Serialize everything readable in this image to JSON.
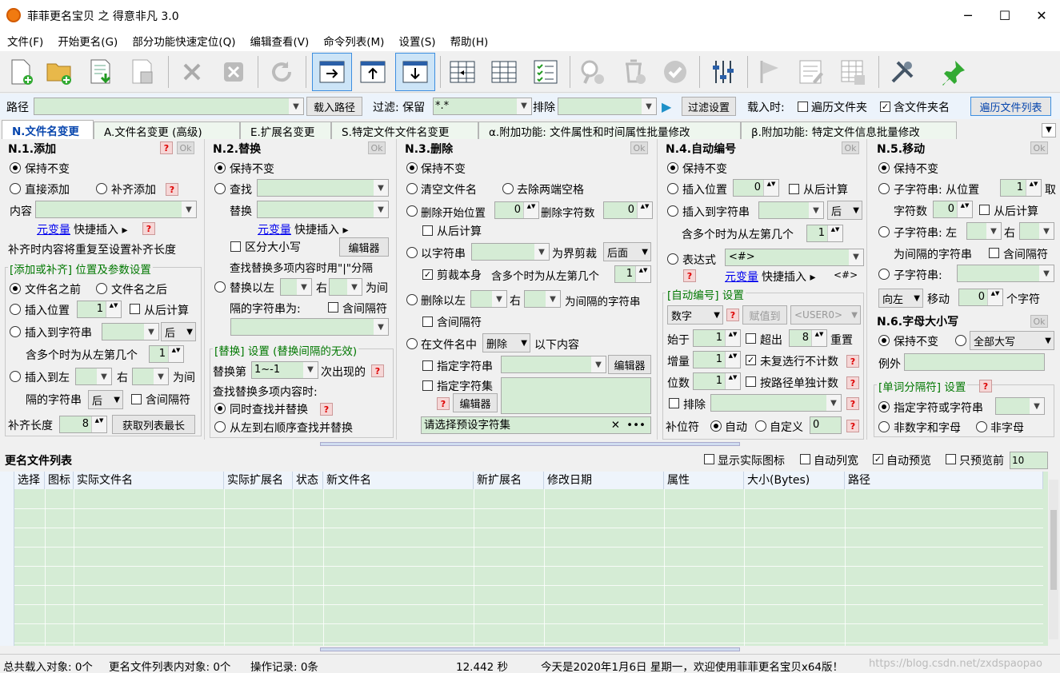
{
  "window": {
    "title": "菲菲更名宝贝 之 得意非凡 3.0",
    "min": "─",
    "max": "☐",
    "close": "✕"
  },
  "menu": [
    "文件(F)",
    "开始更名(G)",
    "部分功能快速定位(Q)",
    "编辑查看(V)",
    "命令列表(M)",
    "设置(S)",
    "帮助(H)"
  ],
  "pathbar": {
    "path_label": "路径",
    "load_path": "载入路径",
    "filter_label": "过滤: 保留",
    "filter_value": "*.*",
    "exclude_label": "排除",
    "filter_settings": "过滤设置",
    "on_load": "载入时:",
    "traverse_folder": "遍历文件夹",
    "include_folder_name": "含文件夹名",
    "traverse_list": "遍历文件列表"
  },
  "tabs": [
    "N.文件名变更",
    "A.文件名变更 (高级)",
    "E.扩展名变更",
    "S.特定文件文件名变更",
    "α.附加功能: 文件属性和时间属性批量修改",
    "β.附加功能: 特定文件信息批量修改"
  ],
  "common": {
    "ok": "Ok",
    "q": "?",
    "after": "后",
    "left": "左",
    "right": "右",
    "ex_tpl": "<#>"
  },
  "p1": {
    "title": "N.1.添加",
    "keep": "保持不变",
    "direct_add": "直接添加",
    "pad_add": "补齐添加",
    "content": "内容",
    "var": "元变量",
    "quick_insert": "快捷插入 ▸",
    "pad_note": "补齐时内容将重复至设置补齐长度",
    "group": "[添加或补齐] 位置及参数设置",
    "before_name": "文件名之前",
    "after_name": "文件名之后",
    "insert_pos": "插入位置",
    "pos_val": "1",
    "from_end": "从后计算",
    "insert_to_str": "插入到字符串",
    "multi_left": "含多个时为从左第几个",
    "multi_val": "1",
    "insert_left": "插入到左",
    "right": "右",
    "as_between": "为间",
    "between_str": "隔的字符串",
    "contain_sep": "含间隔符",
    "pad_len": "补齐长度",
    "pad_val": "8",
    "get_max": "获取列表最长"
  },
  "p2": {
    "title": "N.2.替换",
    "keep": "保持不变",
    "find": "查找",
    "replace": "替换",
    "var": "元变量",
    "quick_insert": "快捷插入 ▸",
    "case": "区分大小写",
    "editor": "编辑器",
    "multi_note": "查找替换多项内容时用\"|\"分隔",
    "replace_left": "替换以左",
    "right": "右",
    "as_between": "为间",
    "between_str": "隔的字符串为:",
    "contain_sep": "含间隔符",
    "group": "[替换] 设置 (替换间隔的无效)",
    "replace_nth": "替换第",
    "nth_val": "1~-1",
    "nth_suffix": "次出现的",
    "multi_find": "查找替换多项内容时:",
    "simultaneous": "同时查找并替换",
    "lr_order": "从左到右顺序查找并替换"
  },
  "p3": {
    "title": "N.3.删除",
    "keep": "保持不变",
    "clear": "清空文件名",
    "trim": "去除两端空格",
    "del_start": "删除开始位置",
    "start_val": "0",
    "del_count": "删除字符数",
    "count_val": "0",
    "from_end": "从后计算",
    "by_str": "以字符串",
    "as_cut": "为界剪裁",
    "after": "后面",
    "cut_self": "剪裁本身",
    "multi_left": "含多个时为从左第几个",
    "multi_val": "1",
    "del_left": "删除以左",
    "right": "右",
    "as_between": "为间隔的字符串",
    "contain_sep": "含间隔符",
    "in_name": "在文件名中",
    "delete_op": "删除",
    "following": "以下内容",
    "spec_str": "指定字符串",
    "editor": "编辑器",
    "spec_set": "指定字符集",
    "preset": "请选择预设字符集",
    "preset_x": "✕",
    "preset_more": "•••"
  },
  "p4": {
    "title": "N.4.自动编号",
    "keep": "保持不变",
    "insert_pos": "插入位置",
    "pos_val": "0",
    "from_end": "从后计算",
    "insert_to_str": "插入到字符串",
    "multi_left": "含多个时为从左第几个",
    "multi_val": "1",
    "expr": "表达式",
    "var": "元变量",
    "quick_insert": "快捷插入 ▸",
    "group": "[自动编号] 设置",
    "num_type": "数字",
    "assign": "赋值到",
    "user0": "<USER0>",
    "start": "始于",
    "start_val": "1",
    "over": "超出",
    "over_val": "8",
    "reset": "重置",
    "step": "增量",
    "step_val": "1",
    "no_dup": "未复选行不计数",
    "digits": "位数",
    "digits_val": "1",
    "by_path": "按路径单独计数",
    "exclude": "排除",
    "pad_char": "补位符",
    "auto": "自动",
    "custom": "自定义",
    "custom_val": "0"
  },
  "p5": {
    "title": "N.5.移动",
    "keep": "保持不变",
    "substr_from": "子字符串: 从位置",
    "from_val": "1",
    "take": "取",
    "char_count": "字符数",
    "count_val": "0",
    "from_end": "从后计算",
    "substr_left": "子字符串: 左",
    "right": "右",
    "between": "为间隔的字符串",
    "contain_sep": "含间隔符",
    "substr": "子字符串:",
    "direction": "向左",
    "move": "移动",
    "move_val": "0",
    "chars": "个字符"
  },
  "p6": {
    "title": "N.6.字母大小写",
    "keep": "保持不变",
    "mode": "全部大写",
    "except": "例外",
    "group": "[单词分隔符] 设置",
    "spec": "指定字符或字符串",
    "non_alnum": "非数字和字母",
    "non_letter": "非字母"
  },
  "list": {
    "title": "更名文件列表",
    "show_icon": "显示实际图标",
    "auto_width": "自动列宽",
    "auto_preview": "自动预览",
    "preview_first": "只预览前",
    "preview_n": "10",
    "columns": [
      "选择",
      "图标",
      "实际文件名",
      "实际扩展名",
      "状态",
      "新文件名",
      "新扩展名",
      "修改日期",
      "属性",
      "大小(Bytes)",
      "路径"
    ]
  },
  "status": {
    "loaded": "总共载入对象: 0个",
    "in_list": "更名文件列表内对象: 0个",
    "ops": "操作记录: 0条",
    "time": "12.442 秒",
    "welcome": "今天是2020年1月6日 星期一，欢迎使用菲菲更名宝贝x64版！",
    "watermark": "https://blog.csdn.net/zxdspaopao"
  }
}
